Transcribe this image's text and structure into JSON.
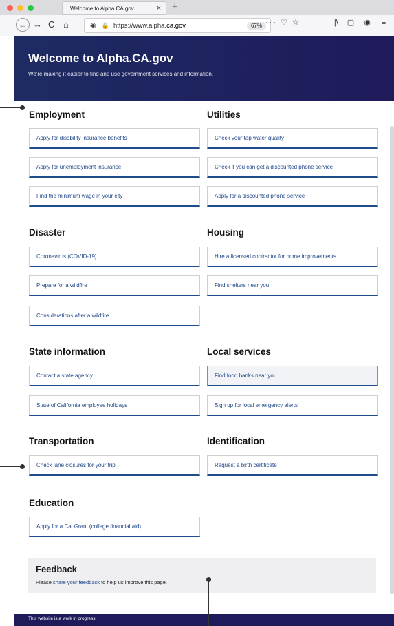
{
  "browser": {
    "tab_title": "Welcome to Alpha.CA.gov",
    "tab_close": "×",
    "new_tab": "+",
    "url_prefix": "https://www.alpha.",
    "url_domain": "ca.gov",
    "zoom": "67%",
    "back_icon": "←",
    "forward_icon": "→",
    "reload_icon": "C",
    "home_icon": "⌂",
    "page_actions": "··· ♡ ☆",
    "toolbar_icons": [
      "|||\\",
      "▢",
      "◉",
      "≡"
    ],
    "traffic_lights": [
      "#ff5f57",
      "#febc2e",
      "#28c840"
    ]
  },
  "hero": {
    "title": "Welcome to Alpha.CA.gov",
    "subtitle": "We're making it easier to find and use government services and information."
  },
  "sections": {
    "employment": {
      "title": "Employment",
      "links": [
        "Apply for disability insurance benefits",
        "Apply for unemployment insurance",
        "Find the minimum wage in your city"
      ]
    },
    "utilities": {
      "title": "Utilities",
      "links": [
        "Check your tap water quality",
        "Check if you can get a discounted phone service",
        "Apply for a discounted phone service"
      ]
    },
    "disaster": {
      "title": "Disaster",
      "links": [
        "Coronavirus (COVID-19)",
        "Prepare for a wildfire",
        "Considerations after a wildfire"
      ]
    },
    "housing": {
      "title": "Housing",
      "links": [
        "Hire a licensed contractor for home improvements",
        "Find shelters near you"
      ]
    },
    "state_information": {
      "title": "State information",
      "links": [
        "Contact a state agency",
        "State of California employee holidays"
      ]
    },
    "local_services": {
      "title": "Local services",
      "links": [
        "Find food banks near you",
        "Sign up for local emergency alerts"
      ]
    },
    "transportation": {
      "title": "Transportation",
      "links": [
        "Check lane closures for your trip"
      ]
    },
    "identification": {
      "title": "Identification",
      "links": [
        "Request a birth certificate"
      ]
    },
    "education": {
      "title": "Education",
      "links": [
        "Apply for a Cal Grant (college financial aid)"
      ]
    }
  },
  "feedback": {
    "title": "Feedback",
    "text_before": "Please ",
    "link": "share your feedback",
    "text_after": " to help us improve this page."
  },
  "footer": {
    "text": "This website is a work in progress."
  },
  "colors": {
    "hero_bg": "#1f1a5a",
    "link": "#1f4687",
    "card_accent": "#1f4d8c"
  }
}
